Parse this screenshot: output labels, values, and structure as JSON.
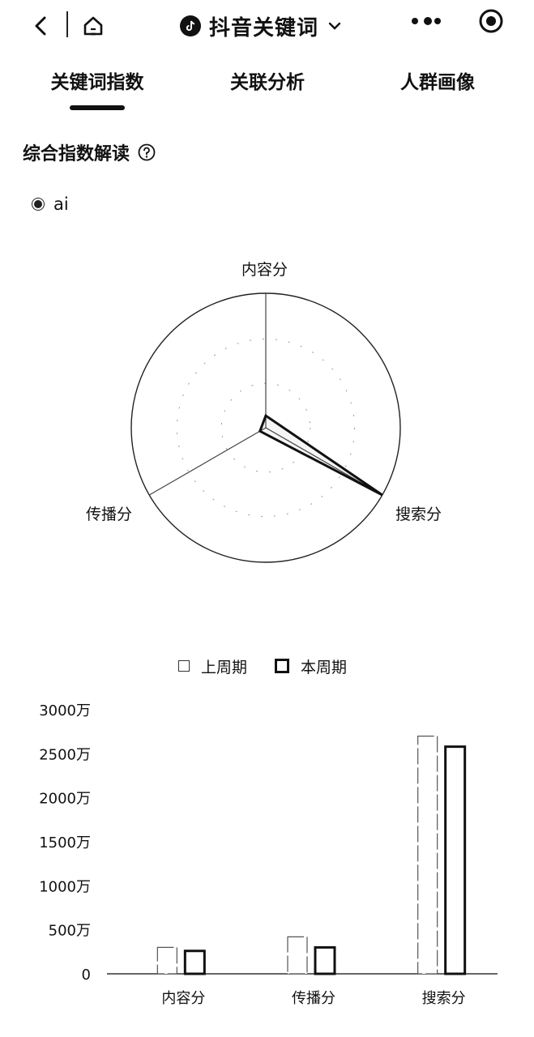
{
  "header": {
    "app_title": "抖音关键词",
    "icons": {
      "back": "back-arrow-icon",
      "home": "home-icon",
      "logo": "tiktok-logo-icon",
      "dropdown": "chevron-down-icon",
      "more": "more-dots-icon",
      "target": "target-circle-icon"
    }
  },
  "tabs": [
    {
      "label": "关键词指数",
      "active": true
    },
    {
      "label": "关联分析",
      "active": false
    },
    {
      "label": "人群画像",
      "active": false
    }
  ],
  "section": {
    "title": "综合指数解读",
    "help_icon": "question-circle-icon"
  },
  "radar": {
    "series_name": "ai",
    "axes": [
      "内容分",
      "搜索分",
      "传播分"
    ],
    "values": [
      0.09,
      1.0,
      0.05
    ]
  },
  "chart_data": {
    "type": "bar",
    "categories": [
      "内容分",
      "传播分",
      "搜索分"
    ],
    "series": [
      {
        "name": "上周期",
        "values": [
          300,
          420,
          2700
        ]
      },
      {
        "name": "本周期",
        "values": [
          260,
          300,
          2580
        ]
      }
    ],
    "y_ticks": [
      "0",
      "500万",
      "1000万",
      "1500万",
      "2000万",
      "2500万",
      "3000万"
    ],
    "ylim": [
      0,
      3000
    ],
    "unit": "万"
  }
}
